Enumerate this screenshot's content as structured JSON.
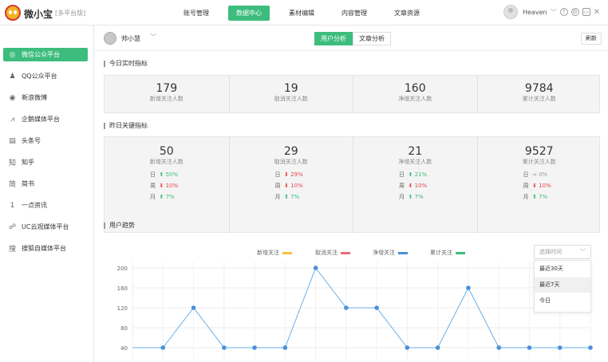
{
  "app": {
    "brand": "微小宝",
    "edition": "[多平台版]"
  },
  "nav": [
    {
      "label": "账号管理"
    },
    {
      "label": "数据中心",
      "active": true
    },
    {
      "label": "素材编辑"
    },
    {
      "label": "内容管理"
    },
    {
      "label": "文章资源"
    }
  ],
  "user": {
    "name": "Heaven"
  },
  "sidebar": {
    "items": [
      {
        "label": "微信公众平台",
        "icon": "wechat-icon",
        "glyph": "◎",
        "active": true
      },
      {
        "label": "QQ公众平台",
        "icon": "qq-icon",
        "glyph": "♟"
      },
      {
        "label": "新浪微博",
        "icon": "weibo-icon",
        "glyph": "◉"
      },
      {
        "label": "企鹅媒体平台",
        "icon": "penguin-icon",
        "glyph": "⩘"
      },
      {
        "label": "头条号",
        "icon": "toutiao-icon",
        "glyph": "▤"
      },
      {
        "label": "知乎",
        "icon": "zhihu-icon",
        "glyph": "知"
      },
      {
        "label": "简书",
        "icon": "jianshu-icon",
        "glyph": "简"
      },
      {
        "label": "一点资讯",
        "icon": "yidian-icon",
        "glyph": "1"
      },
      {
        "label": "UC云观媒体平台",
        "icon": "uc-icon",
        "glyph": "☍"
      },
      {
        "label": "搜狐自媒体平台",
        "icon": "sohu-icon",
        "glyph": "搜"
      }
    ]
  },
  "header": {
    "account": "帅小慧",
    "tabs": [
      {
        "label": "用户分析",
        "active": true
      },
      {
        "label": "文章分析"
      }
    ],
    "refresh": "刷新"
  },
  "today": {
    "title": "今日实时指标",
    "metrics": [
      {
        "value": "179",
        "label": "新增关注人数"
      },
      {
        "value": "19",
        "label": "取消关注人数"
      },
      {
        "value": "160",
        "label": "净增关注人数"
      },
      {
        "value": "9784",
        "label": "累计关注人数"
      }
    ]
  },
  "yesterday": {
    "title": "昨日关键指标",
    "metrics": [
      {
        "value": "50",
        "label": "新增关注人数",
        "cmp": [
          {
            "k": "日",
            "arrow": "⬆",
            "pct": "50%",
            "dir": "up"
          },
          {
            "k": "周",
            "arrow": "⬇",
            "pct": "10%",
            "dir": "down"
          },
          {
            "k": "月",
            "arrow": "⬆",
            "pct": "7%",
            "dir": "up"
          }
        ]
      },
      {
        "value": "29",
        "label": "取消关注人数",
        "cmp": [
          {
            "k": "日",
            "arrow": "⬇",
            "pct": "29%",
            "dir": "down"
          },
          {
            "k": "周",
            "arrow": "⬇",
            "pct": "10%",
            "dir": "down"
          },
          {
            "k": "月",
            "arrow": "⬆",
            "pct": "7%",
            "dir": "up"
          }
        ]
      },
      {
        "value": "21",
        "label": "净增关注人数",
        "cmp": [
          {
            "k": "日",
            "arrow": "⬆",
            "pct": "21%",
            "dir": "up"
          },
          {
            "k": "周",
            "arrow": "⬇",
            "pct": "10%",
            "dir": "down"
          },
          {
            "k": "月",
            "arrow": "⬆",
            "pct": "7%",
            "dir": "up"
          }
        ]
      },
      {
        "value": "9527",
        "label": "累计关注人数",
        "cmp": [
          {
            "k": "日",
            "arrow": "⇒",
            "pct": "0%",
            "dir": "eq"
          },
          {
            "k": "周",
            "arrow": "⬇",
            "pct": "10%",
            "dir": "down"
          },
          {
            "k": "月",
            "arrow": "⬆",
            "pct": "7%",
            "dir": "up"
          }
        ]
      }
    ]
  },
  "trend": {
    "title": "用户趋势",
    "select": {
      "placeholder": "选择时间",
      "options": [
        "最近30天",
        "最近7天",
        "今日"
      ],
      "highlighted": 1
    }
  },
  "colors": {
    "accent": "#3dbd7d",
    "up": "#3dbd7d",
    "down": "#e5464a",
    "line": "#6aaee8"
  },
  "chart_data": {
    "type": "line",
    "series": [
      {
        "name": "新增关注",
        "color": "#f5c242",
        "values": []
      },
      {
        "name": "取消关注",
        "color": "#e96a7a",
        "values": []
      },
      {
        "name": "净增关注",
        "color": "#4a90d9",
        "values": [
          40,
          40,
          120,
          40,
          40,
          40,
          200,
          120,
          120,
          40,
          40,
          160,
          40,
          40,
          40,
          40
        ]
      },
      {
        "name": "累计关注",
        "color": "#3dbd7d",
        "values": []
      }
    ],
    "yticks": [
      200,
      160,
      120,
      80,
      40
    ],
    "ylim": [
      40,
      200
    ],
    "grid": true,
    "legend": "top"
  }
}
